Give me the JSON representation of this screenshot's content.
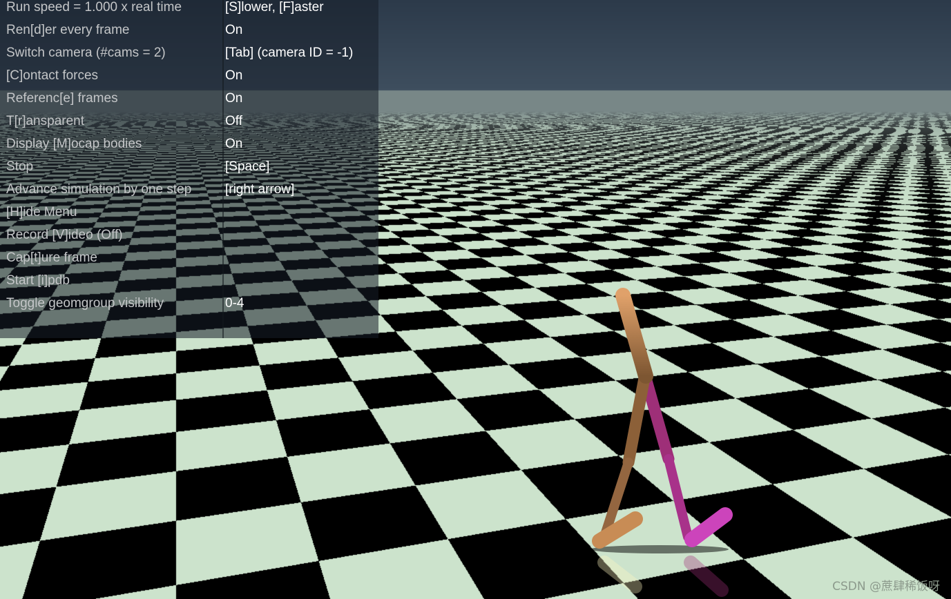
{
  "viewer": {
    "menu": [
      {
        "label": "Run speed = 1.000 x real time",
        "value": "[S]lower, [F]aster"
      },
      {
        "label": "Ren[d]er every frame",
        "value": "On"
      },
      {
        "label": "Switch camera (#cams = 2)",
        "value": "[Tab] (camera ID = -1)"
      },
      {
        "label": "[C]ontact forces",
        "value": "On"
      },
      {
        "label": "Referenc[e] frames",
        "value": "On"
      },
      {
        "label": "T[r]ansparent",
        "value": "Off"
      },
      {
        "label": "Display [M]ocap bodies",
        "value": "On"
      },
      {
        "label": "Stop",
        "value": "[Space]"
      },
      {
        "label": "Advance simulation by one step",
        "value": "[right arrow]"
      },
      {
        "label": "[H]ide Menu",
        "value": ""
      },
      {
        "label": "Record [V]ideo (Off)",
        "value": ""
      },
      {
        "label": "Cap[t]ure frame",
        "value": ""
      },
      {
        "label": "Start [i]pdb",
        "value": ""
      },
      {
        "label": "Toggle geomgroup visibility",
        "value": "0-4"
      }
    ]
  },
  "watermark": "CSDN @蔗肆稀饭呀",
  "colors": {
    "sky": "#2f3d4d",
    "floor_light": "#cce3cc",
    "floor_dark": "#000000",
    "leg_left": "#9a6a42",
    "leg_right": "#a0307a"
  }
}
